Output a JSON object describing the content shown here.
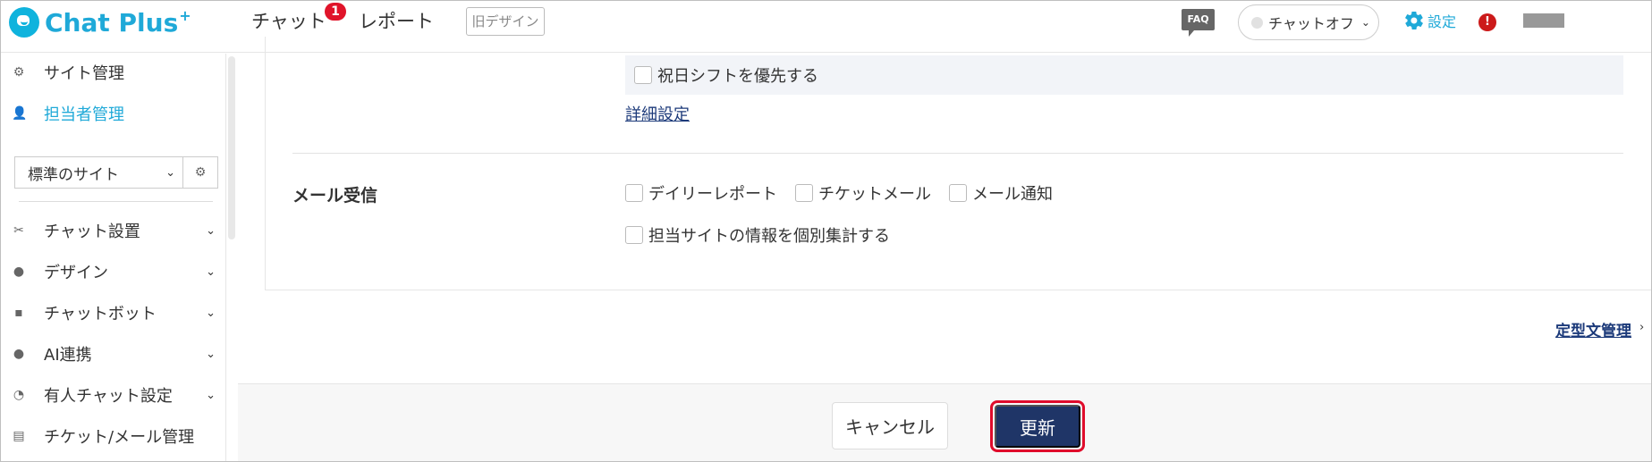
{
  "header": {
    "logo_text": "Chat Plus",
    "logo_sup": "+",
    "nav_chat": "チャット",
    "nav_chat_badge": "1",
    "nav_report": "レポート",
    "old_design": "旧デザイン",
    "faq": "FAQ",
    "chat_status": "チャットオフ",
    "settings": "設定",
    "alert": "!"
  },
  "sidebar": {
    "site_manage": "サイト管理",
    "staff_manage": "担当者管理",
    "site_select": "標準のサイト",
    "items": [
      {
        "label": "チャット設置",
        "icon": "tools-icon"
      },
      {
        "label": "デザイン",
        "icon": "palette-icon"
      },
      {
        "label": "チャットボット",
        "icon": "chat-bubble-icon"
      },
      {
        "label": "AI連携",
        "icon": "brain-icon"
      },
      {
        "label": "有人チャット設定",
        "icon": "headset-icon"
      },
      {
        "label": "チケット/メール管理",
        "icon": "list-icon"
      }
    ]
  },
  "main": {
    "holiday_shift": "祝日シフトを優先する",
    "detail_link": "詳細設定",
    "mail_label": "メール受信",
    "mail_options": [
      "デイリーレポート",
      "チケットメール",
      "メール通知"
    ],
    "aggregate_option": "担当サイトの情報を個別集計する",
    "teikei_link": "定型文管理"
  },
  "footer": {
    "cancel": "キャンセル",
    "update": "更新"
  },
  "colors": {
    "brand": "#1fa9d8",
    "primary_button": "#1f3567",
    "highlight_outline": "#e00c2b",
    "badge": "#e0142a"
  }
}
